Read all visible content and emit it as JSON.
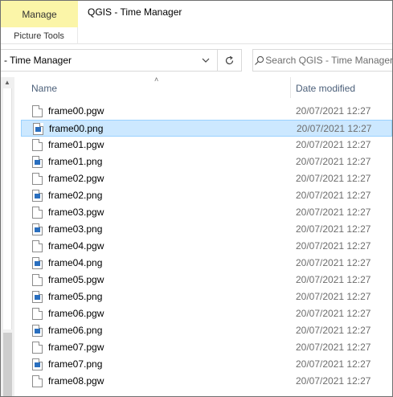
{
  "window": {
    "title": "QGIS - Time Manager"
  },
  "ribbon": {
    "manage_tab": "Manage",
    "picture_tools": "Picture Tools"
  },
  "address_bar": {
    "path": "- Time Manager"
  },
  "search": {
    "placeholder": "Search QGIS - Time Manager"
  },
  "columns": {
    "name": "Name",
    "date_modified": "Date modified"
  },
  "files": [
    {
      "name": "frame00.pgw",
      "date": "20/07/2021 12:27",
      "type": "pgw",
      "selected": false
    },
    {
      "name": "frame00.png",
      "date": "20/07/2021 12:27",
      "type": "png",
      "selected": true
    },
    {
      "name": "frame01.pgw",
      "date": "20/07/2021 12:27",
      "type": "pgw",
      "selected": false
    },
    {
      "name": "frame01.png",
      "date": "20/07/2021 12:27",
      "type": "png",
      "selected": false
    },
    {
      "name": "frame02.pgw",
      "date": "20/07/2021 12:27",
      "type": "pgw",
      "selected": false
    },
    {
      "name": "frame02.png",
      "date": "20/07/2021 12:27",
      "type": "png",
      "selected": false
    },
    {
      "name": "frame03.pgw",
      "date": "20/07/2021 12:27",
      "type": "pgw",
      "selected": false
    },
    {
      "name": "frame03.png",
      "date": "20/07/2021 12:27",
      "type": "png",
      "selected": false
    },
    {
      "name": "frame04.pgw",
      "date": "20/07/2021 12:27",
      "type": "pgw",
      "selected": false
    },
    {
      "name": "frame04.png",
      "date": "20/07/2021 12:27",
      "type": "png",
      "selected": false
    },
    {
      "name": "frame05.pgw",
      "date": "20/07/2021 12:27",
      "type": "pgw",
      "selected": false
    },
    {
      "name": "frame05.png",
      "date": "20/07/2021 12:27",
      "type": "png",
      "selected": false
    },
    {
      "name": "frame06.pgw",
      "date": "20/07/2021 12:27",
      "type": "pgw",
      "selected": false
    },
    {
      "name": "frame06.png",
      "date": "20/07/2021 12:27",
      "type": "png",
      "selected": false
    },
    {
      "name": "frame07.pgw",
      "date": "20/07/2021 12:27",
      "type": "pgw",
      "selected": false
    },
    {
      "name": "frame07.png",
      "date": "20/07/2021 12:27",
      "type": "png",
      "selected": false
    },
    {
      "name": "frame08.pgw",
      "date": "20/07/2021 12:27",
      "type": "pgw",
      "selected": false
    }
  ],
  "colors": {
    "manage_tab_bg": "#fbf5a8",
    "selection_bg": "#cce8ff",
    "selection_border": "#99d1ff",
    "header_text": "#4c607a",
    "date_text": "#6d6d6d"
  },
  "icons": {
    "dropdown": "chevron-down-icon",
    "refresh": "refresh-icon",
    "search": "search-icon",
    "sort": "sort-ascending-icon",
    "pgw_file": "document-icon",
    "png_file": "image-file-icon"
  }
}
